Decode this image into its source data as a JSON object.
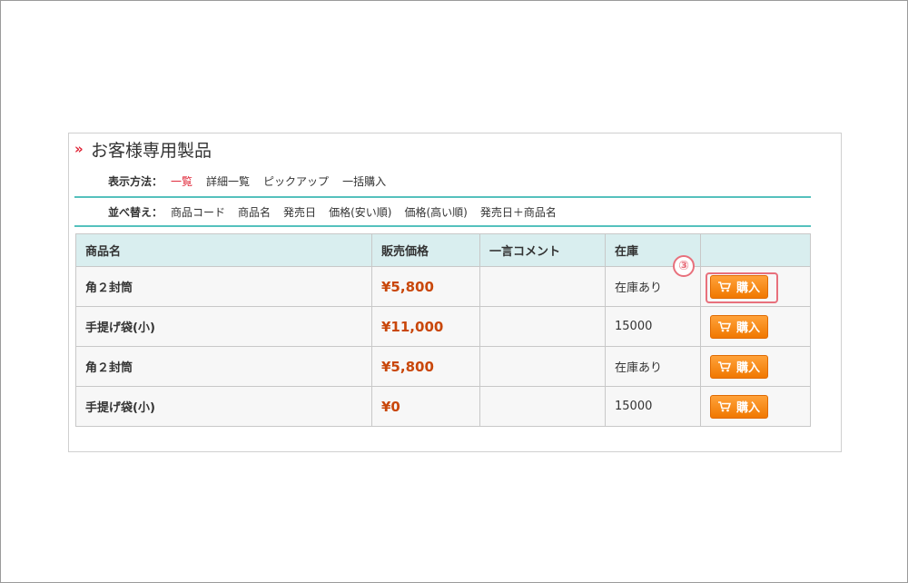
{
  "page": {
    "title": "お客様専用製品",
    "title_marker": "»"
  },
  "view": {
    "label": "表示方法：",
    "options": [
      "一覧",
      "詳細一覧",
      "ピックアップ",
      "一括購入"
    ],
    "active_index": 0
  },
  "sort": {
    "label": "並べ替え：",
    "options": [
      "商品コード",
      "商品名",
      "発売日",
      "価格(安い順)",
      "価格(高い順)",
      "発売日＋商品名"
    ]
  },
  "table": {
    "headers": [
      "商品名",
      "販売価格",
      "一言コメント",
      "在庫",
      ""
    ],
    "rows": [
      {
        "name": "角２封筒",
        "price": "¥5,800",
        "comment": "",
        "stock": "在庫あり",
        "button": "購入"
      },
      {
        "name": "手提げ袋(小)",
        "price": "¥11,000",
        "comment": "",
        "stock": "15000",
        "button": "購入"
      },
      {
        "name": "角２封筒",
        "price": "¥5,800",
        "comment": "",
        "stock": "在庫あり",
        "button": "購入"
      },
      {
        "name": "手提げ袋(小)",
        "price": "¥0",
        "comment": "",
        "stock": "15000",
        "button": "購入"
      }
    ]
  },
  "annotation": {
    "step": "③"
  },
  "colors": {
    "accent_red": "#e0283a",
    "price": "#c9470a",
    "rule": "#55c1bd",
    "header_bg": "#d9eeef",
    "button_orange": "#f07800",
    "annotation": "#e8707c"
  },
  "icons": {
    "title_marker": "double-chevron-right-icon",
    "button": "cart-icon"
  }
}
